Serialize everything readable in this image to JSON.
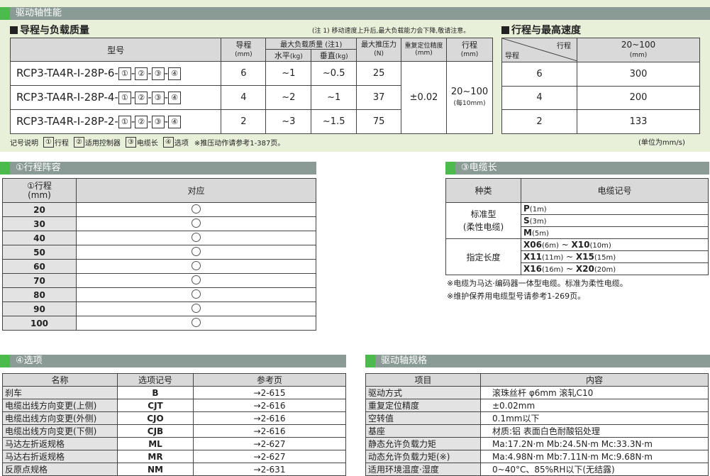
{
  "top_section": {
    "title": "驱动轴性能",
    "lead_table": {
      "title": "导程与负载质量",
      "note": "(注 1) 移动速度上升后,最大负载能力会下降,敬请注意。",
      "headers": {
        "model": "型号",
        "lead": "导程",
        "lead_unit": "(mm)",
        "max_load": "最大负载质量 (注1)",
        "horizontal": "水平",
        "horizontal_unit": "(kg)",
        "vertical": "垂直",
        "vertical_unit": "(kg)",
        "max_push": "最大推压力",
        "max_push_unit": "(N)",
        "repeat": "重复定位精度",
        "repeat_unit": "(mm)",
        "stroke": "行程",
        "stroke_unit": "(mm)"
      },
      "rows": [
        {
          "model": "RCP3-TA4R-I-28P-6-",
          "lead": "6",
          "horizontal": "~1",
          "vertical": "~0.5",
          "push": "25"
        },
        {
          "model": "RCP3-TA4R-I-28P-4-",
          "lead": "4",
          "horizontal": "~2",
          "vertical": "~1",
          "push": "37"
        },
        {
          "model": "RCP3-TA4R-I-28P-2-",
          "lead": "2",
          "horizontal": "~3",
          "vertical": "~1.5",
          "push": "75"
        }
      ],
      "repeat_value": "±0.02",
      "stroke_value": "20~100",
      "stroke_step": "(每10mm)",
      "model_codes": [
        "①",
        "②",
        "③",
        "④"
      ],
      "legend_label": "记号说明",
      "legend_items": [
        {
          "num": "①",
          "label": "行程"
        },
        {
          "num": "②",
          "label": "适用控制器"
        },
        {
          "num": "③",
          "label": "电缆长"
        },
        {
          "num": "④",
          "label": "选项"
        }
      ],
      "legend_note": "※推压动作请参考1-387页。"
    },
    "speed_table": {
      "title": "行程与最高速度",
      "corner_top": "行程",
      "corner_bottom": "导程",
      "col_header": "20~100",
      "col_unit": "(mm)",
      "rows": [
        {
          "lead": "6",
          "speed": "300"
        },
        {
          "lead": "4",
          "speed": "200"
        },
        {
          "lead": "2",
          "speed": "133"
        }
      ],
      "unit_note": "(单位为mm/s)"
    }
  },
  "stroke_section": {
    "title": "①行程阵容",
    "header_stroke": "①行程",
    "header_unit": "(mm)",
    "header_support": "对应",
    "rows": [
      "20",
      "30",
      "40",
      "50",
      "60",
      "70",
      "80",
      "90",
      "100"
    ]
  },
  "cable_section": {
    "title": "③电缆长",
    "header_type": "种类",
    "header_code": "电缆记号",
    "standard_label": "标准型",
    "standard_sub": "(柔性电缆)",
    "standard_rows": [
      {
        "code": "P",
        "len": "(1m)"
      },
      {
        "code": "S",
        "len": "(3m)"
      },
      {
        "code": "M",
        "len": "(5m)"
      }
    ],
    "custom_label": "指定长度",
    "custom_rows": [
      {
        "a": "X06",
        "al": "(6m)",
        "b": "X10",
        "bl": "(10m)"
      },
      {
        "a": "X11",
        "al": "(11m)",
        "b": "X15",
        "bl": "(15m)"
      },
      {
        "a": "X16",
        "al": "(16m)",
        "b": "X20",
        "bl": "(20m)"
      }
    ],
    "note1": "※电缆为马达·编码器一体型电缆。标准为柔性电缆。",
    "note2": "※维护保养用电缆型号请参考1-269页。"
  },
  "option_section": {
    "title": "④选项",
    "headers": [
      "名称",
      "选项记号",
      "参考页"
    ],
    "rows": [
      {
        "name": "刹车",
        "code": "B",
        "page": "→2-615"
      },
      {
        "name": "电缆出线方向变更(上侧)",
        "code": "CJT",
        "page": "→2-616"
      },
      {
        "name": "电缆出线方向变更(外侧)",
        "code": "CJO",
        "page": "→2-616"
      },
      {
        "name": "电缆出线方向变更(下侧)",
        "code": "CJB",
        "page": "→2-616"
      },
      {
        "name": "马达左折返规格",
        "code": "ML",
        "page": "→2-627"
      },
      {
        "name": "马达右折返规格",
        "code": "MR",
        "page": "→2-627"
      },
      {
        "name": "反原点规格",
        "code": "NM",
        "page": "→2-631"
      }
    ]
  },
  "spec_section": {
    "title": "驱动轴规格",
    "headers": [
      "项目",
      "内容"
    ],
    "rows": [
      {
        "item": "驱动方式",
        "content": "滚珠丝杆  φ6mm  滚轧C10"
      },
      {
        "item": "重复定位精度",
        "content": "±0.02mm"
      },
      {
        "item": "空转值",
        "content": "0.1mm以下"
      },
      {
        "item": "基座",
        "content": "材质:铝  表面白色耐酸铝处理"
      },
      {
        "item": "静态允许负载力矩",
        "content": "Ma:17.2N·m  Mb:24.5N·m  Mc:33.3N·m"
      },
      {
        "item": "动态允许负载力矩(※)",
        "content": "Ma:4.98N·m  Mb:7.11N·m  Mc:9.68N·m"
      },
      {
        "item": "适用环境温度·湿度",
        "content": "0~40°C、85%RH以下(无结露)"
      }
    ]
  }
}
